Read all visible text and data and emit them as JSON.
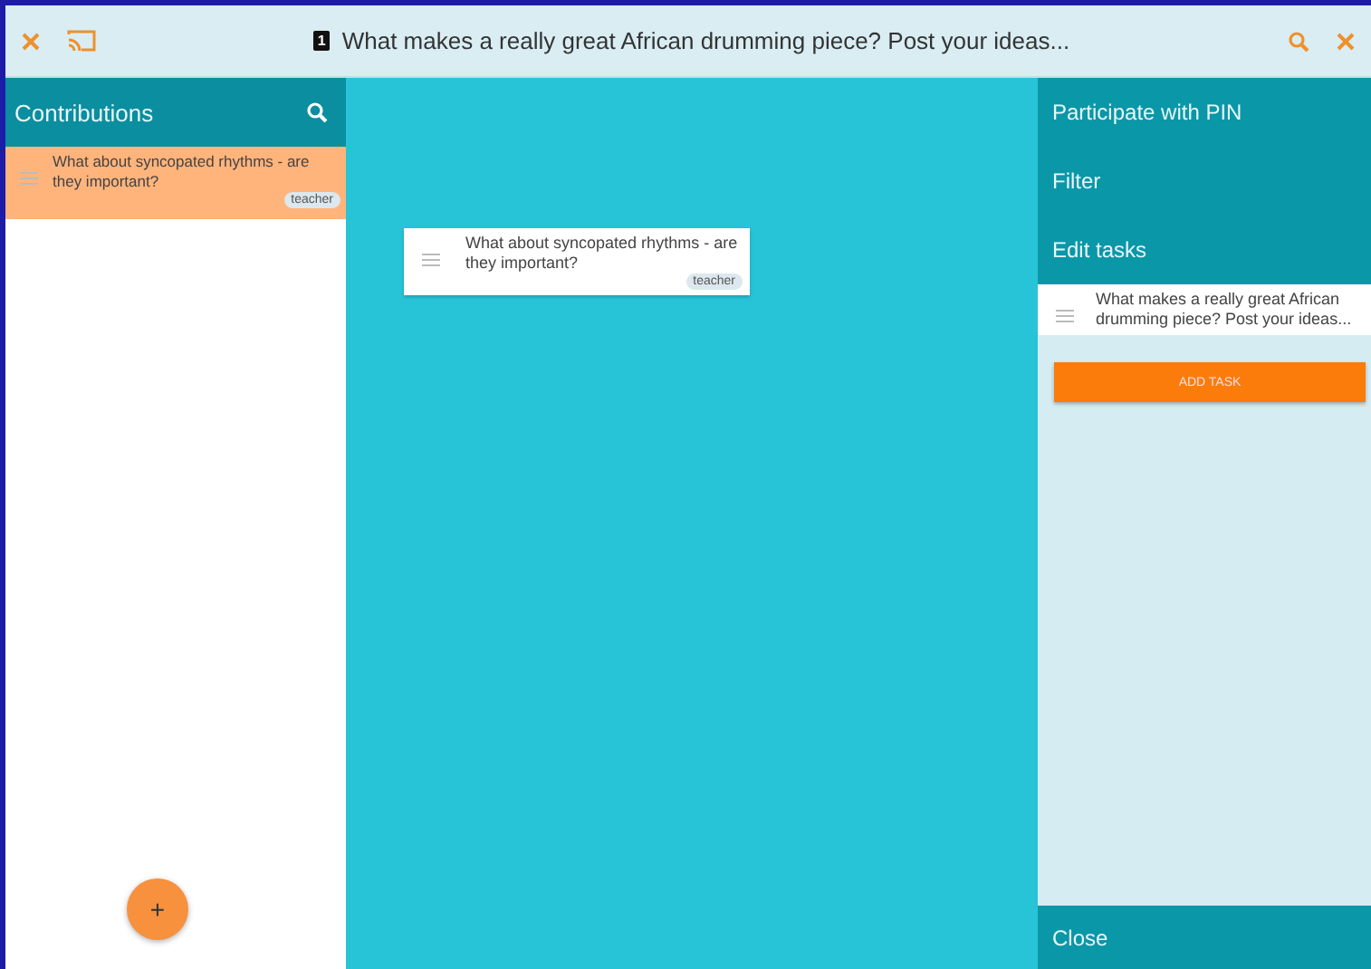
{
  "top_bar": {
    "badge": "1",
    "title": "What makes a really great African drumming piece? Post your ideas..."
  },
  "contributions": {
    "title": "Contributions",
    "items": [
      {
        "text": "What about syncopated rhythms - are they important?",
        "tag": "teacher",
        "selected": true
      }
    ],
    "add_button": "+"
  },
  "canvas": {
    "cards": [
      {
        "text": "What about syncopated rhythms - are they important?",
        "tag": "teacher"
      }
    ]
  },
  "side_menu": {
    "items": [
      {
        "label": "Participate with PIN"
      },
      {
        "label": "Filter"
      },
      {
        "label": "Edit tasks"
      }
    ],
    "tasks": [
      {
        "text": "What makes a really great African drumming piece? Post your ideas..."
      }
    ],
    "add_task": "ADD TASK",
    "close": "Close"
  }
}
